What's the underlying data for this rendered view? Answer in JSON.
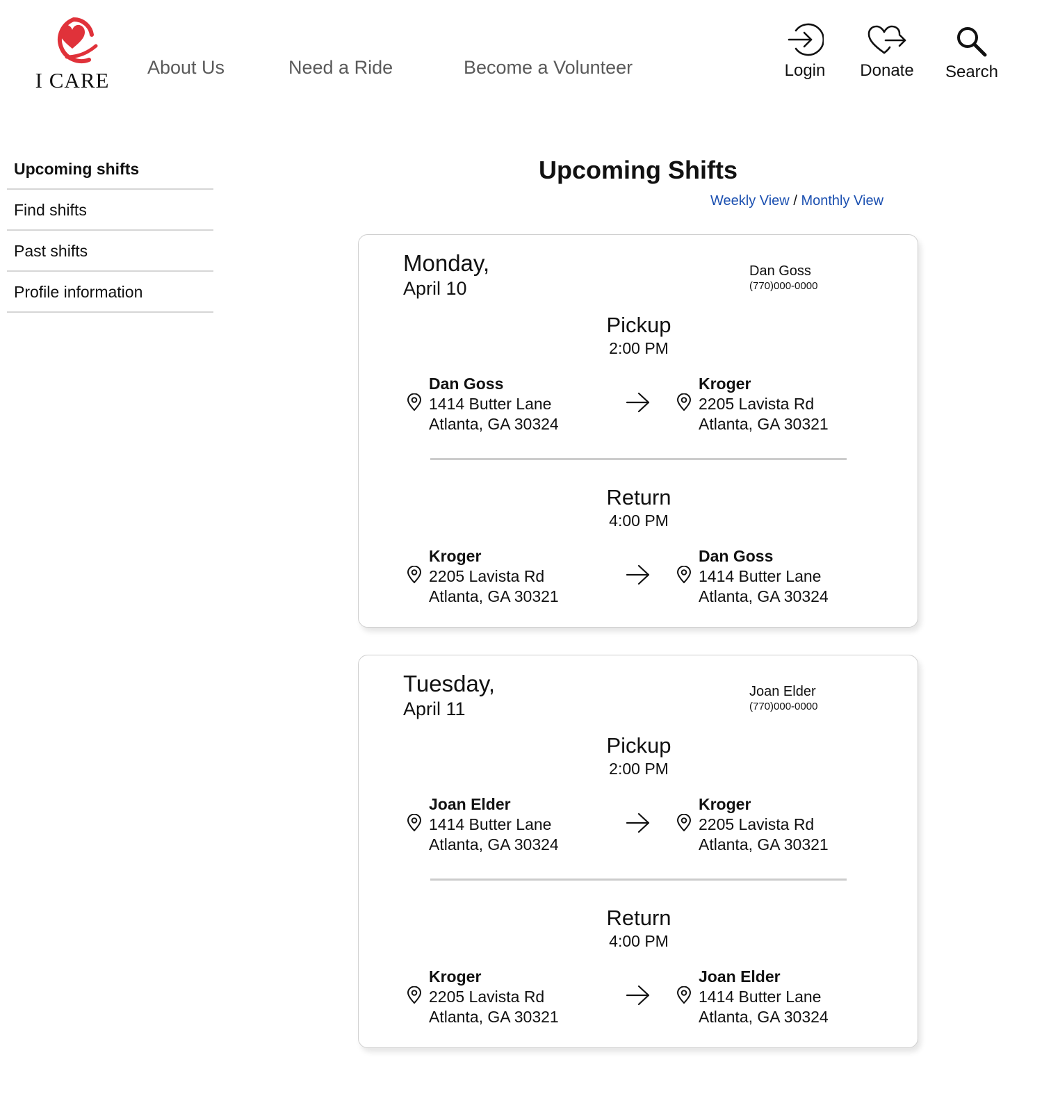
{
  "brand": {
    "name": "I CARE",
    "accent": "#e0323a"
  },
  "nav": {
    "about": "About Us",
    "ride": "Need a Ride",
    "volunteer": "Become a Volunteer"
  },
  "utility": {
    "login": {
      "label": "Login",
      "icon": "login-arrow-icon"
    },
    "donate": {
      "label": "Donate",
      "icon": "heart-arrow-icon"
    },
    "search": {
      "label": "Search",
      "icon": "magnifier-icon"
    }
  },
  "sidebar": {
    "items": [
      {
        "label": "Upcoming shifts",
        "active": true
      },
      {
        "label": "Find shifts"
      },
      {
        "label": "Past shifts"
      },
      {
        "label": "Profile information"
      }
    ]
  },
  "main": {
    "title": "Upcoming Shifts",
    "weekly": "Weekly View",
    "separator": "/",
    "monthly": "Monthly View",
    "link_color": "#1a4fb0"
  },
  "shifts": [
    {
      "day": "Monday,",
      "date": "April 10",
      "client": "Dan Goss",
      "phone": "(770)000-0000",
      "pickup": {
        "title": "Pickup",
        "time": "2:00 PM",
        "from": {
          "name": "Dan Goss",
          "street": "1414 Butter Lane",
          "city": "Atlanta, GA 30324"
        },
        "to": {
          "name": "Kroger",
          "street": "2205 Lavista Rd",
          "city": "Atlanta, GA 30321"
        }
      },
      "return": {
        "title": "Return",
        "time": "4:00 PM",
        "from": {
          "name": "Kroger",
          "street": "2205 Lavista Rd",
          "city": "Atlanta, GA 30321"
        },
        "to": {
          "name": "Dan Goss",
          "street": "1414 Butter Lane",
          "city": "Atlanta, GA 30324"
        }
      }
    },
    {
      "day": "Tuesday,",
      "date": "April 11",
      "client": "Joan Elder",
      "phone": "(770)000-0000",
      "pickup": {
        "title": "Pickup",
        "time": "2:00 PM",
        "from": {
          "name": "Joan Elder",
          "street": "1414 Butter Lane",
          "city": "Atlanta, GA 30324"
        },
        "to": {
          "name": "Kroger",
          "street": "2205 Lavista Rd",
          "city": "Atlanta, GA 30321"
        }
      },
      "return": {
        "title": "Return",
        "time": "4:00 PM",
        "from": {
          "name": "Kroger",
          "street": "2205 Lavista Rd",
          "city": "Atlanta, GA 30321"
        },
        "to": {
          "name": "Joan Elder",
          "street": "1414 Butter Lane",
          "city": "Atlanta, GA 30324"
        }
      }
    }
  ]
}
